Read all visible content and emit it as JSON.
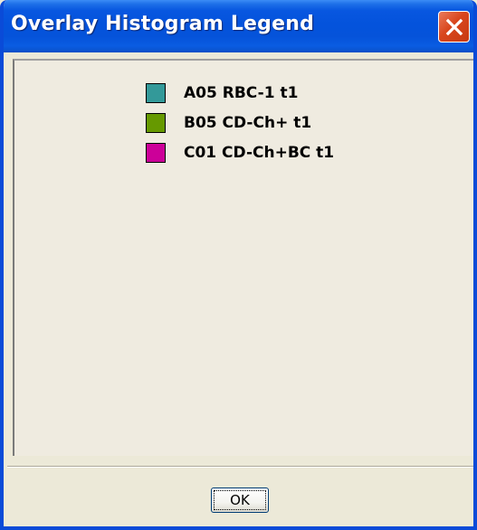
{
  "window": {
    "title": "Overlay Histogram Legend"
  },
  "legend": {
    "items": [
      {
        "label": "A05 RBC-1 t1",
        "color": "#339999"
      },
      {
        "label": "B05 CD-Ch+ t1",
        "color": "#669900"
      },
      {
        "label": "C01 CD-Ch+BC t1",
        "color": "#cc0099"
      }
    ]
  },
  "footer": {
    "ok_label": "OK"
  },
  "icons": {
    "close": "close-icon"
  }
}
